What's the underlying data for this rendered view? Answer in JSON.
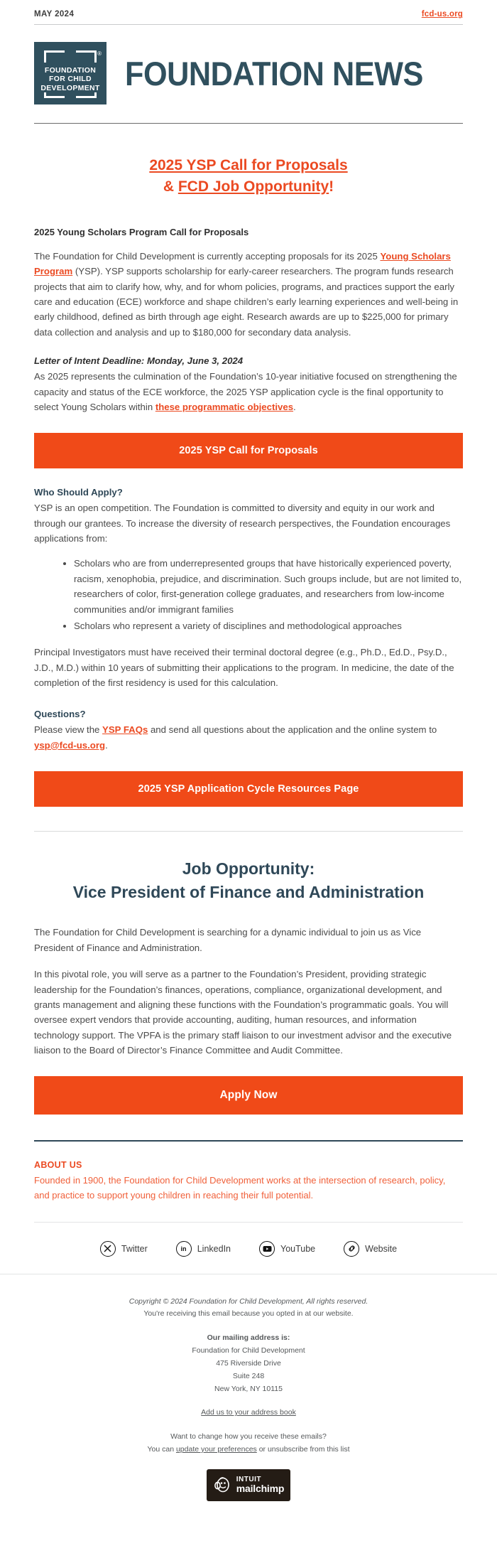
{
  "preheader": {
    "date": "MAY 2024",
    "site_link": "fcd-us.org"
  },
  "masthead": {
    "logo_line1": "FOUNDATION",
    "logo_line2": "FOR CHILD",
    "logo_line3": "DEVELOPMENT",
    "registered_mark": "®",
    "title": "FOUNDATION NEWS"
  },
  "headline": {
    "line1": "2025 YSP Call for Proposals",
    "line2_amp": "& ",
    "line2_link": "FCD Job Opportunity",
    "line2_bang": "!"
  },
  "ysp": {
    "section_title": "2025 Young Scholars Program Call for Proposals",
    "intro_p1_a": "The Foundation for Child Development is currently accepting proposals for its 2025 ",
    "intro_p1_link": "Young Scholars Program",
    "intro_p1_b": " (YSP). YSP supports scholarship for early-career researchers. The program funds research projects that aim to clarify how, why, and for whom policies, programs, and practices support the early care and education (ECE) workforce and shape children’s early learning experiences and well-being in early childhood, defined as birth through age eight. Research awards are up to $225,000 for primary data collection and analysis and up to $180,000 for secondary data analysis.",
    "deadline": "Letter of Intent Deadline: Monday, June 3, 2024",
    "intro_p2_a": "As 2025 represents the culmination of the Foundation’s 10-year initiative focused on strengthening the capacity and status of the ECE workforce, the 2025 YSP application cycle is the final opportunity to select Young Scholars within ",
    "intro_p2_link": "these programmatic objectives",
    "intro_p2_b": ".",
    "cta1_label": "2025 YSP Call for Proposals",
    "who_heading": "Who Should Apply?",
    "who_p": "YSP is an open competition. The Foundation is committed to diversity and equity in our work and through our grantees. To increase the diversity of research perspectives, the Foundation encourages applications from:",
    "who_bullets": [
      "Scholars who are from underrepresented groups that have historically experienced poverty, racism, xenophobia, prejudice, and discrimination. Such groups include, but are not limited to, researchers of color, first-generation college graduates, and researchers from low-income communities and/or immigrant families",
      "Scholars who represent a variety of disciplines and methodological approaches"
    ],
    "pi_p": "Principal Investigators must have received their terminal doctoral degree (e.g., Ph.D., Ed.D., Psy.D., J.D., M.D.) within 10 years of submitting their applications to the program. In medicine, the date of the completion of the first residency is used for this calculation.",
    "questions_heading": "Questions?",
    "questions_a": "Please view the ",
    "questions_link1": "YSP FAQs",
    "questions_b": " and send all questions about the application and the online system to ",
    "questions_link2": "ysp@fcd-us.org",
    "questions_c": ".",
    "cta2_label": "2025 YSP Application Cycle Resources Page"
  },
  "job": {
    "heading_line1": "Job Opportunity:",
    "heading_line2": "Vice President of Finance and Administration",
    "p1": "The Foundation for Child Development is searching for a dynamic individual to join us as Vice President of Finance and Administration.",
    "p2": "In this pivotal role, you will serve as a partner to the Foundation’s President, providing strategic leadership for the Foundation’s finances, operations, compliance, organizational development, and grants management and aligning these functions with the Foundation’s programmatic goals. You will oversee expert vendors that provide accounting, auditing, human resources, and information technology support. The VPFA is the primary staff liaison to our investment advisor and the executive liaison to the Board of Director’s Finance Committee and Audit Committee.",
    "cta_label": "Apply Now"
  },
  "about": {
    "label": "ABOUT US",
    "text": "Founded in 1900, the Foundation for Child Development works at the intersection of research, policy, and practice to support young children in reaching their full potential."
  },
  "socials": [
    {
      "icon": "twitter-x-icon",
      "label": "Twitter"
    },
    {
      "icon": "linkedin-icon",
      "label": "LinkedIn"
    },
    {
      "icon": "youtube-icon",
      "label": "YouTube"
    },
    {
      "icon": "link-icon",
      "label": "Website"
    }
  ],
  "footer": {
    "copyright": "Copyright © 2024 Foundation for Child Development, All rights reserved.",
    "optin": "You're receiving this email because you opted in at our website.",
    "address_label": "Our mailing address is:",
    "address_line1": "Foundation for Child Development",
    "address_line2": "475 Riverside Drive",
    "address_line3": "Suite 248",
    "address_line4": "New York, NY 10115",
    "address_book_link": "Add us to your address book",
    "prefs_question": "Want to change how you receive these emails?",
    "prefs_a": "You can ",
    "prefs_link": "update your preferences",
    "prefs_b": " or unsubscribe from this list",
    "mailchimp_intuit": "INTUIT",
    "mailchimp_name": "mailchimp"
  },
  "colors": {
    "accent_orange": "#eb4a22",
    "cta_orange": "#f04a18",
    "brand_slate": "#30505e",
    "heading_slate": "#2f4858"
  }
}
